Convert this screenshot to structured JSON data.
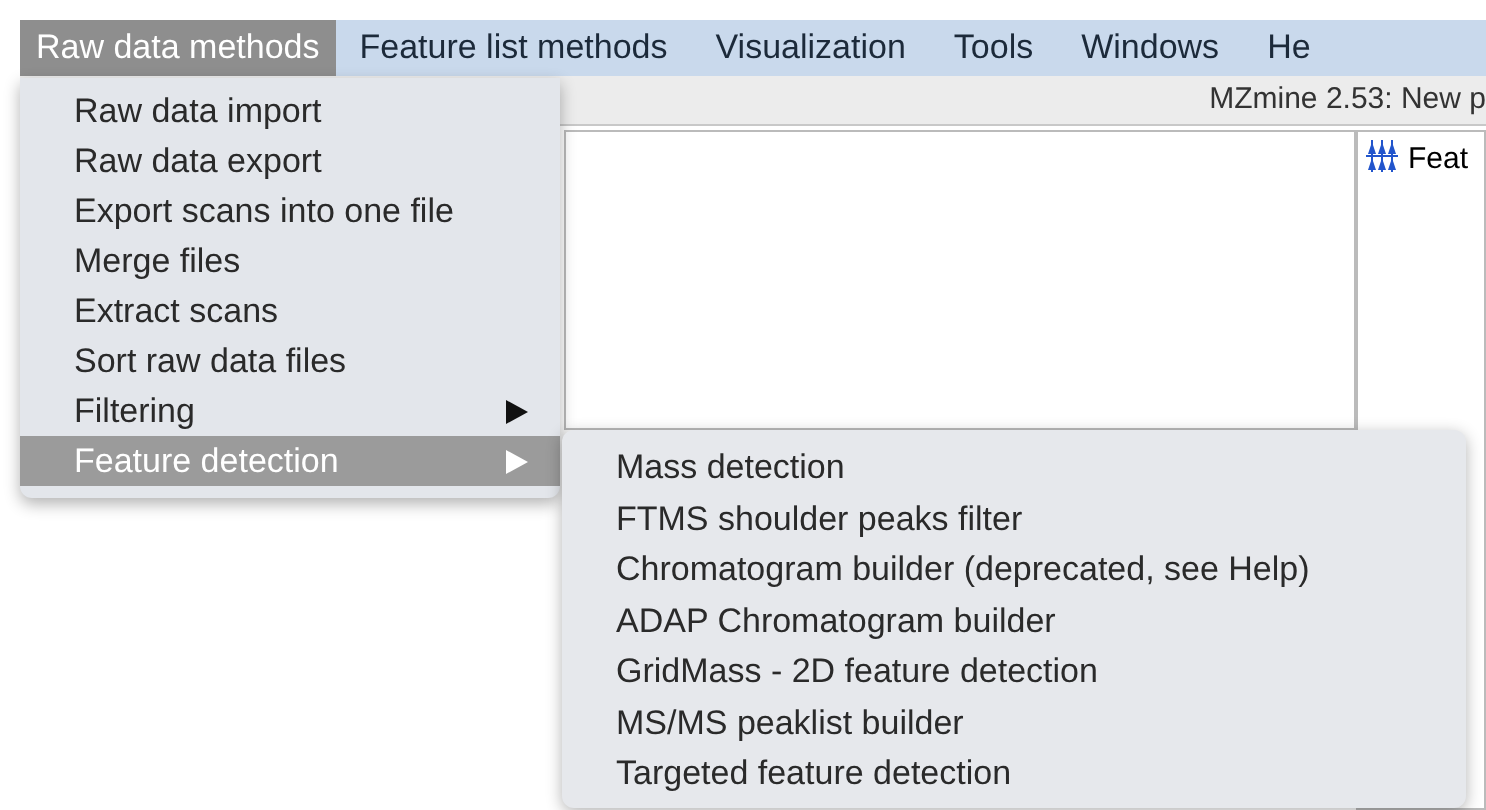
{
  "menu_bar": [
    {
      "label": "Raw data methods",
      "selected": true
    },
    {
      "label": "Feature list methods",
      "selected": false
    },
    {
      "label": "Visualization",
      "selected": false
    },
    {
      "label": "Tools",
      "selected": false
    },
    {
      "label": "Windows",
      "selected": false
    },
    {
      "label": "He",
      "selected": false
    }
  ],
  "window": {
    "title": "MZmine 2.53: New p"
  },
  "side_panel": {
    "item": "Feat"
  },
  "dropdown": {
    "items": [
      {
        "label": "Raw data import",
        "submenu": false,
        "selected": false
      },
      {
        "label": "Raw data export",
        "submenu": false,
        "selected": false
      },
      {
        "label": "Export scans into one file",
        "submenu": false,
        "selected": false
      },
      {
        "label": "Merge files",
        "submenu": false,
        "selected": false
      },
      {
        "label": "Extract scans",
        "submenu": false,
        "selected": false
      },
      {
        "label": "Sort raw data files",
        "submenu": false,
        "selected": false
      },
      {
        "label": "Filtering",
        "submenu": true,
        "selected": false
      },
      {
        "label": "Feature detection",
        "submenu": true,
        "selected": true
      }
    ]
  },
  "submenu": {
    "items": [
      {
        "label": "Mass detection"
      },
      {
        "label": "FTMS shoulder peaks filter"
      },
      {
        "label": "Chromatogram builder (deprecated, see Help)"
      },
      {
        "label": "ADAP Chromatogram builder"
      },
      {
        "label": "GridMass - 2D feature detection"
      },
      {
        "label": "MS/MS peaklist builder"
      },
      {
        "label": "Targeted feature detection"
      }
    ]
  }
}
